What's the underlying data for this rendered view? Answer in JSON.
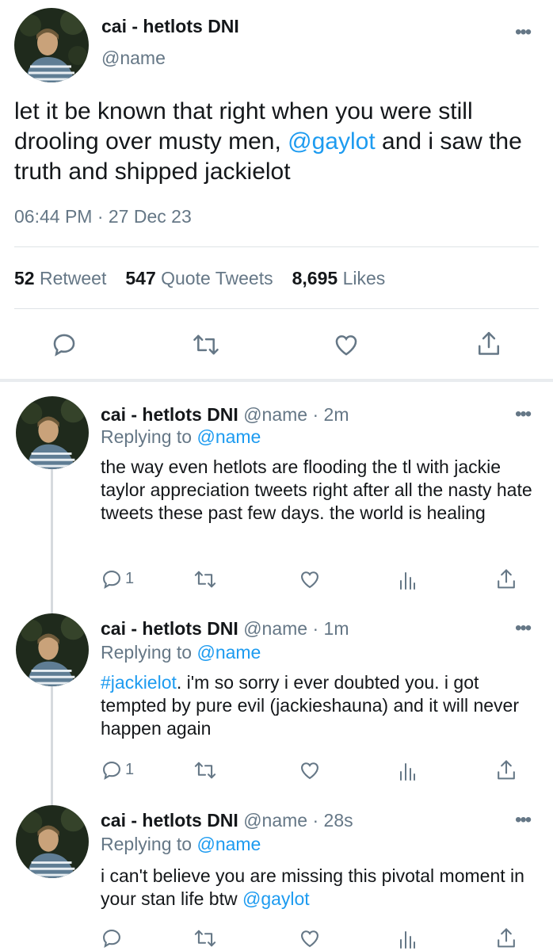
{
  "main_tweet": {
    "display_name": "cai - hetlots DNI",
    "handle": "@name",
    "text_before": "let it be known that right when you were still drooling over musty men, ",
    "mention": "@gaylot",
    "text_after": " and i saw the truth and shipped jackielot",
    "timestamp": "06:44 PM · 27 Dec 23",
    "stats": {
      "retweets_count": "52",
      "retweets_label": "Retweet",
      "quotes_count": "547",
      "quotes_label": "Quote Tweets",
      "likes_count": "8,695",
      "likes_label": "Likes"
    }
  },
  "replies": [
    {
      "display_name": "cai - hetlots DNI",
      "handle_time": "@name · 2m",
      "replying_label": "Replying to",
      "replying_to": "@name",
      "text_prefix": "",
      "text": "the way even hetlots are flooding the tl with jackie taylor appreciation tweets right after all the nasty hate tweets these past few days. the world is healing",
      "text_mention": "",
      "reply_count": "1"
    },
    {
      "display_name": "cai - hetlots DNI",
      "handle_time": "@name · 1m",
      "replying_label": "Replying to",
      "replying_to": "@name",
      "text_prefix": "#jackielot",
      "text": ". i'm so sorry i ever doubted you. i got tempted by pure evil (jackieshauna) and it will never happen again",
      "text_mention": "",
      "reply_count": "1"
    },
    {
      "display_name": "cai - hetlots DNI",
      "handle_time": "@name · 28s",
      "replying_label": "Replying to",
      "replying_to": "@name",
      "text_prefix": "",
      "text": "i can't believe you are missing this pivotal moment in your stan life btw ",
      "text_mention": "@gaylot",
      "reply_count": ""
    }
  ],
  "colors": {
    "accent": "#1d9bf0",
    "muted": "#657786",
    "divider": "#dfe3e6"
  }
}
